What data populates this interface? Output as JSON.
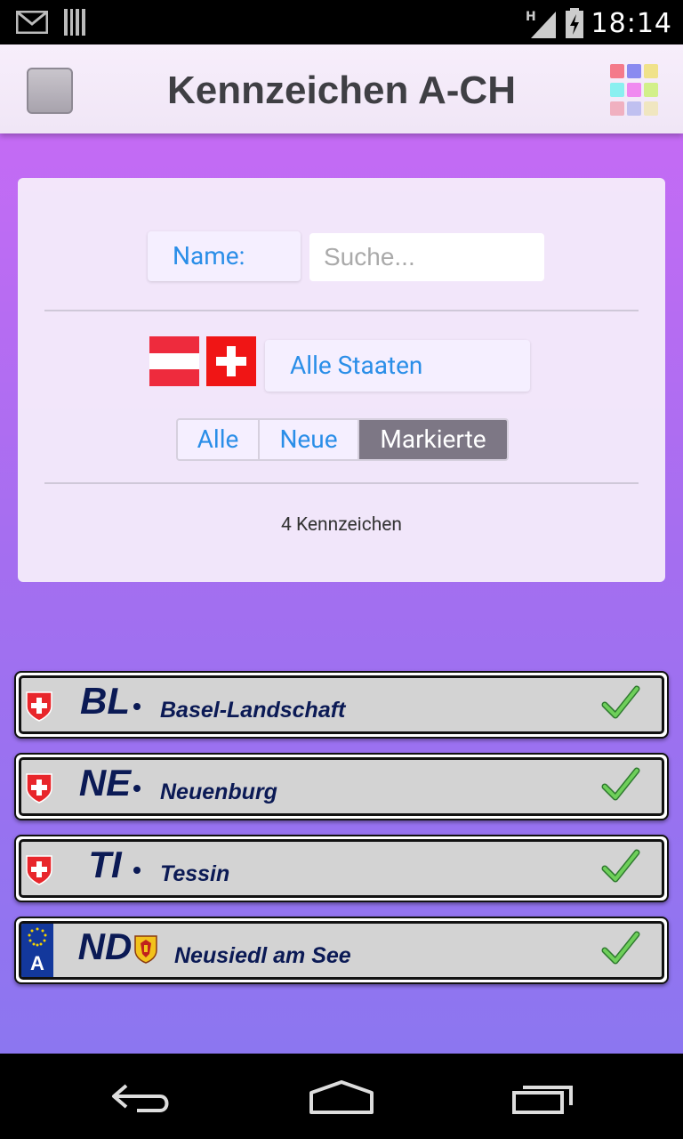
{
  "status_bar": {
    "time": "18:14",
    "network": "H"
  },
  "app_bar": {
    "title": "Kennzeichen A-CH",
    "grid_colors": [
      "#f47a8a",
      "#8a8af0",
      "#f0e28a",
      "#8af0f0",
      "#f08af0",
      "#d2f08a",
      "#f0b0c0",
      "#c0c0f0",
      "#f0e6c0"
    ]
  },
  "filter": {
    "name_label": "Name:",
    "search_placeholder": "Suche...",
    "state_select": "Alle Staaten",
    "segments": [
      "Alle",
      "Neue",
      "Markierte"
    ],
    "selected_segment": "Markierte",
    "count_text": "4 Kennzeichen"
  },
  "plates": [
    {
      "code": "BL",
      "name": "Basel-Landschaft",
      "country": "CH",
      "marked": true
    },
    {
      "code": "NE",
      "name": "Neuenburg",
      "country": "CH",
      "marked": true
    },
    {
      "code": "TI",
      "name": "Tessin",
      "country": "CH",
      "marked": true
    },
    {
      "code": "ND",
      "name": "Neusiedl am See",
      "country": "A",
      "country_letter": "A",
      "marked": true
    }
  ],
  "colors": {
    "accent_text": "#2a8ee8",
    "plate_text": "#0b1a55",
    "selected_segment": "#7d7785",
    "background_top": "#c46bf4",
    "background_bottom": "#8c76f0"
  }
}
